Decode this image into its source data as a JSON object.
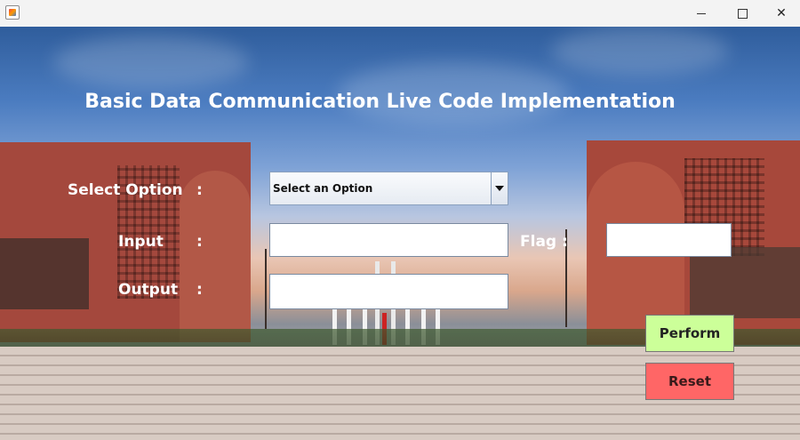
{
  "window": {
    "title": "",
    "controls": {
      "minimize": "—",
      "maximize": "☐",
      "close": "✕"
    }
  },
  "main": {
    "heading": "Basic Data Communication Live Code Implementation",
    "select_option_label": "Select Option",
    "select_option_colon": ":",
    "select_value": "Select an Option",
    "input_label": "Input",
    "input_colon": ":",
    "input_value": "",
    "flag_label": "Flag",
    "flag_colon": ":",
    "flag_value": "",
    "output_label": "Output",
    "output_colon": ":",
    "output_value": "",
    "perform_label": "Perform",
    "reset_label": "Reset"
  },
  "colors": {
    "perform_bg": "#ccff99",
    "reset_bg": "#ff6666",
    "label_text": "#ffffff"
  }
}
